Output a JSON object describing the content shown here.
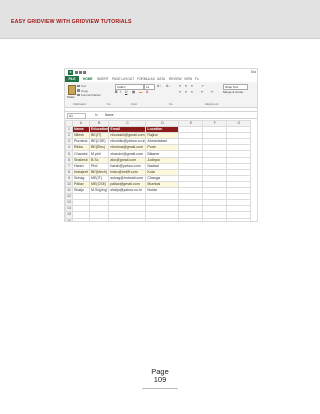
{
  "document": {
    "header_title": "EASY GRIDVIEW WITH GRIDVIEW TUTORIALS",
    "page_label": "Page",
    "page_number": "109"
  },
  "excel": {
    "qat": {
      "logo": "X",
      "right_text": "Sta"
    },
    "ribbon_tabs": [
      "FILE",
      "HOME",
      "INSERT",
      "PAGE LAYOUT",
      "FORMULAS",
      "DATA",
      "REVIEW",
      "VIEW",
      "Fo"
    ],
    "clipboard": {
      "paste": "Paste",
      "cut": "Cut",
      "copy": "Copy",
      "format_painter": "Format Painter"
    },
    "font": {
      "name": "Calibri",
      "size": "11"
    },
    "alignment": {
      "wrap_text": "Wrap Text",
      "merge_center": "Merge & Cente"
    },
    "groups": [
      "Clipboard",
      "Fo",
      "Font",
      "Fo",
      "Alignment"
    ],
    "formula_bar": {
      "cell": "A1",
      "fx": "fx",
      "value": "Name"
    },
    "columns": [
      "A",
      "B",
      "C",
      "D",
      "E",
      "F",
      "G"
    ],
    "rows": [
      [
        "Name",
        "Education",
        "Email",
        "Location"
      ],
      [
        "Nilesh",
        "BE(IT)",
        "nilcosta3@gmail.com",
        "Rajkot"
      ],
      [
        "Purnima",
        "BE(CSE)",
        "nilcohilu@yahoo.co.in",
        "Ahmedabad"
      ],
      [
        "Rinku",
        "BE(Elec)",
        "nilurima@gmail.com",
        "Pune"
      ],
      [
        "Chandni",
        "M.phil",
        "chandni@gmail.com",
        "Bikaner"
      ],
      [
        "Shailesh",
        "B.Sc",
        "abc@gmail.com",
        "Jodhpur"
      ],
      [
        "Harsh",
        "Phd",
        "harsh@yahoo.com",
        "Nadiad"
      ],
      [
        "Indrajeet",
        "BE(Mech)",
        "indru@rediff.com",
        "Kota"
      ],
      [
        "Suhag",
        "ME(IT)",
        "suhag@hotmail.com",
        "Changa"
      ],
      [
        "Pallav",
        "ME(CSE)",
        "pallav@gmail.com",
        "Mumbai"
      ],
      [
        "Shaiju",
        "M.Sc(phy)",
        "shaiju@yahoo.co.in",
        "Noida"
      ],
      [
        "",
        "",
        "",
        ""
      ],
      [
        "",
        "",
        "",
        ""
      ],
      [
        "",
        "",
        "",
        ""
      ],
      [
        "",
        "",
        "",
        ""
      ],
      [
        "",
        "",
        "",
        ""
      ]
    ],
    "row_numbers": [
      "1",
      "2",
      "3",
      "4",
      "5",
      "6",
      "7",
      "8",
      "9",
      "10",
      "11",
      "12",
      "13",
      "14",
      "15",
      "16"
    ]
  }
}
